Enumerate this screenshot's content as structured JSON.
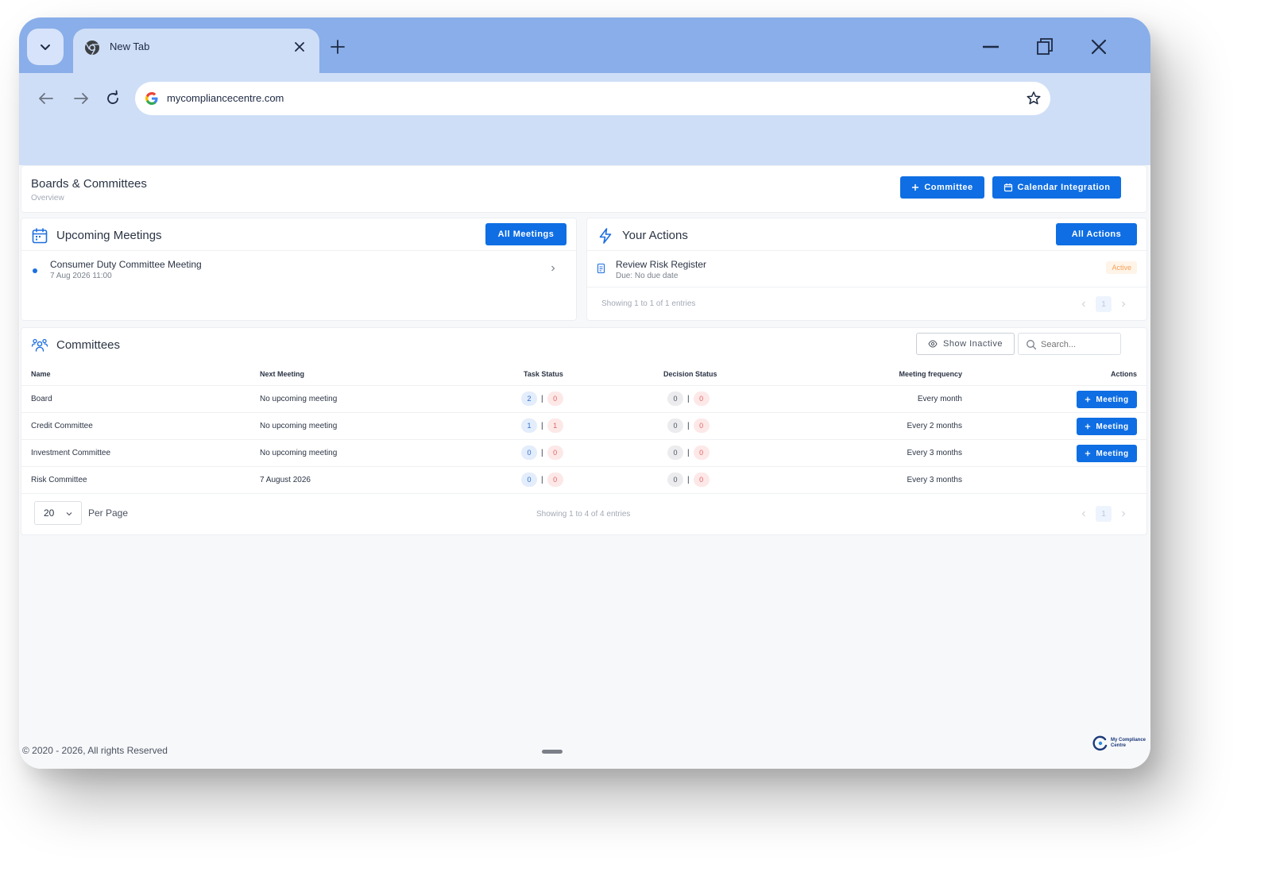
{
  "browser": {
    "tab_title": "New Tab",
    "url": "mycompliancecentre.com"
  },
  "header": {
    "title": "Boards & Committees",
    "subtitle": "Overview",
    "committee_button": "Committee",
    "calendar_button": "Calendar Integration"
  },
  "upcoming": {
    "title": "Upcoming Meetings",
    "all_button": "All Meetings",
    "items": [
      {
        "title": "Consumer Duty Committee Meeting",
        "date": "7 Aug 2026 11:00"
      }
    ]
  },
  "actions": {
    "title": "Your Actions",
    "all_button": "All Actions",
    "items": [
      {
        "title": "Review Risk Register",
        "due": "Due: No due date",
        "status": "Active"
      }
    ],
    "showing": "Showing 1 to 1 of 1 entries",
    "page": "1"
  },
  "committees": {
    "title": "Committees",
    "show_inactive": "Show Inactive",
    "search_placeholder": "Search...",
    "columns": [
      "Name",
      "Next Meeting",
      "Task Status",
      "Decision Status",
      "Meeting frequency",
      "Actions"
    ],
    "separator": "|",
    "meeting_button": "Meeting",
    "rows": [
      {
        "name": "Board",
        "next": "No upcoming meeting",
        "task_open": "2",
        "task_overdue": "0",
        "decision_open": "0",
        "decision_overdue": "0",
        "frequency": "Every month"
      },
      {
        "name": "Credit Committee",
        "next": "No upcoming meeting",
        "task_open": "1",
        "task_overdue": "1",
        "decision_open": "0",
        "decision_overdue": "0",
        "frequency": "Every 2 months"
      },
      {
        "name": "Investment Committee",
        "next": "No upcoming meeting",
        "task_open": "0",
        "task_overdue": "0",
        "decision_open": "0",
        "decision_overdue": "0",
        "frequency": "Every 3 months"
      },
      {
        "name": "Risk Committee",
        "next": "7 August 2026",
        "task_open": "0",
        "task_overdue": "0",
        "decision_open": "0",
        "decision_overdue": "0",
        "frequency": "Every 3 months"
      }
    ],
    "per_page_value": "20",
    "per_page_label": "Per Page",
    "showing": "Showing 1 to 4 of 4 entries",
    "page": "1"
  },
  "footer": {
    "copyright": "© 2020 - 2026, All rights Reserved",
    "logo_line1": "My Compliance",
    "logo_line2": "Centre"
  },
  "colors": {
    "primary": "#0f6ee3",
    "tab_strip": "#89aee9",
    "toolbar": "#cfdef7",
    "active_badge": "#f4a259"
  }
}
